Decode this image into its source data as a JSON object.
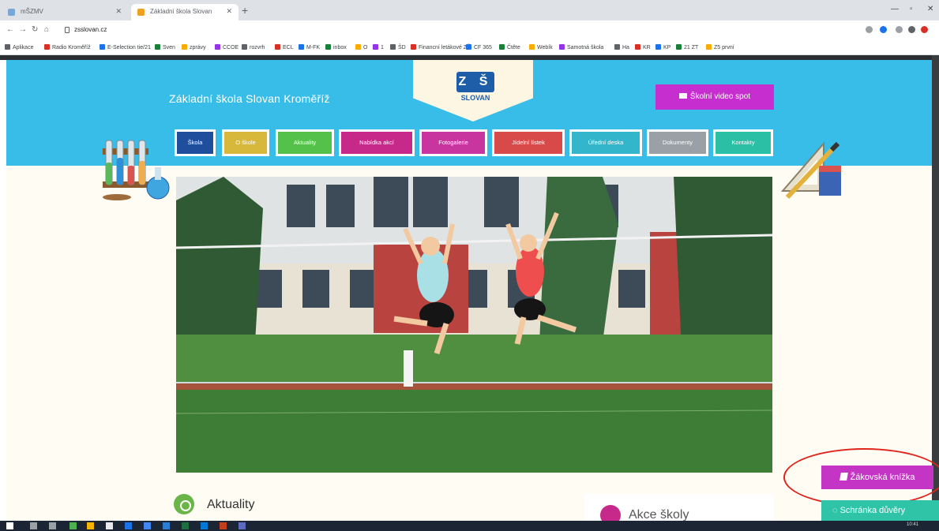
{
  "browser": {
    "tabs": [
      {
        "title": "mŠZMV",
        "active": false
      },
      {
        "title": "Základní škola Slovan",
        "active": true
      }
    ],
    "url": "zsslovan.cz",
    "bookmarks": [
      "Aplikace",
      "Radio Kroměříž",
      "E-Selection tie/21",
      "Sven",
      "zprávy",
      "CCOE",
      "rozvrh",
      "ECL",
      "M-FK",
      "inbox",
      "O",
      "1",
      "ŠD",
      "Financní letákové ZŠ",
      "CF 365",
      "Čtěte",
      "Webík",
      "Samotná škola",
      "Ha",
      "KR",
      "KP",
      "21 ZT",
      "Z5 první"
    ]
  },
  "site": {
    "title": "Základní škola Slovan Kroměříž",
    "logo_letters": "Z Š",
    "logo_name": "SLOVAN",
    "video_button": "Školní video spot",
    "nav": [
      {
        "label": "Škola",
        "color": "#1f4e9c"
      },
      {
        "label": "O škole",
        "color": "#d7b83a"
      },
      {
        "label": "Aktuality",
        "color": "#54c14b"
      },
      {
        "label": "Nabídka akcí",
        "color": "#c7298a"
      },
      {
        "label": "Fotogalerie",
        "color": "#c9359f"
      },
      {
        "label": "Jídelní lístek",
        "color": "#d84a4a"
      },
      {
        "label": "Úřední deska",
        "color": "#33b6cc"
      },
      {
        "label": "Dokumenty",
        "color": "#9aa0a6"
      },
      {
        "label": "Kontakty",
        "color": "#2bbfa5"
      }
    ],
    "news_heading": "Aktuality",
    "events_heading": "Akce školy",
    "student_book_button": "Žákovská knížka",
    "trust_box_button": "Schránka důvěry"
  },
  "taskbar": {
    "clock": "10:41"
  }
}
